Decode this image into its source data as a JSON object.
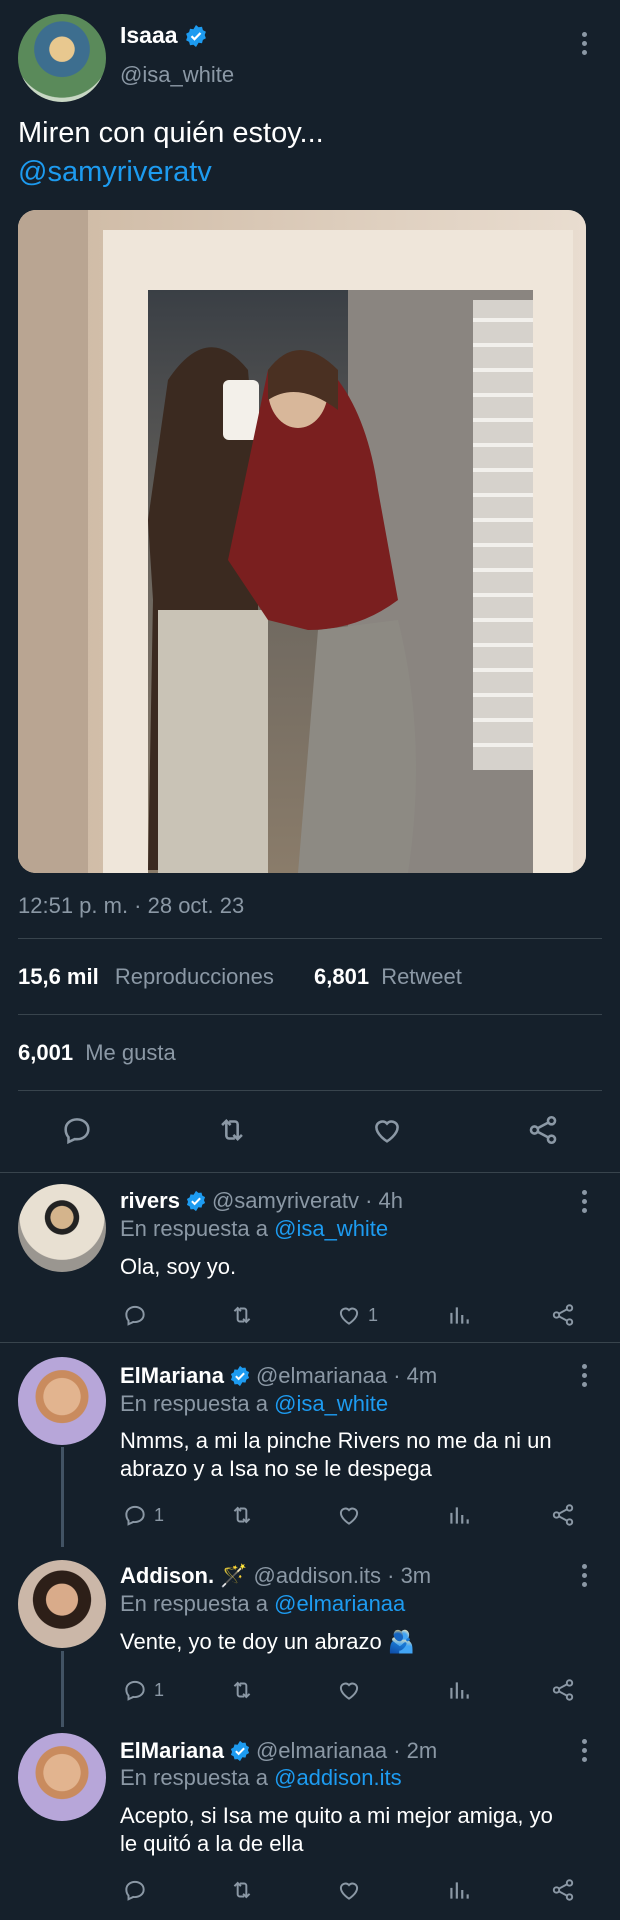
{
  "tweet": {
    "author_name": "Isaaa",
    "author_handle": "@isa_white",
    "text_line1": "Miren con quién estoy...",
    "text_mention": "@samyriveratv",
    "timestamp": "12:51 p. m. · 28 oct. 23",
    "views_count": "15,6 mil",
    "views_label": "Reproducciones",
    "retweet_count": "6,801",
    "retweet_label": "Retweet",
    "likes_count": "6,001",
    "likes_label": "Me gusta"
  },
  "replies": [
    {
      "name": "rivers",
      "handle_time": "@samyriveratv · 4h",
      "reply_prefix": "En respuesta a",
      "reply_to": "@isa_white",
      "text": "Ola, soy yo.",
      "reply_count": "",
      "like_count": "1"
    },
    {
      "name": "ElMariana",
      "handle_time": "@elmarianaa · 4m",
      "reply_prefix": "En respuesta a",
      "reply_to": "@isa_white",
      "text_line1": "Nmms, a mi la pinche Rivers no me da ni un",
      "text_line2": "abrazo y a Isa no se le despega",
      "reply_count": "1",
      "like_count": ""
    },
    {
      "name": "Addison.",
      "name_emoji": "🪄",
      "handle_time": "@addison.its · 3m",
      "reply_prefix": "En respuesta a",
      "reply_to": "@elmarianaa",
      "text": "Vente, yo te doy un abrazo 🫂",
      "reply_count": "1",
      "like_count": ""
    },
    {
      "name": "ElMariana",
      "handle_time": "@elmarianaa · 2m",
      "reply_prefix": "En respuesta a",
      "reply_to": "@addison.its",
      "text_line1": "Acepto, si Isa me quito a mi mejor amiga, yo",
      "text_line2": "le quitó a la de ella",
      "reply_count": "",
      "like_count": ""
    }
  ],
  "colors": {
    "background": "#15202b",
    "accent": "#1d9bf0",
    "muted": "#8b98a5",
    "divider": "#38444d"
  }
}
